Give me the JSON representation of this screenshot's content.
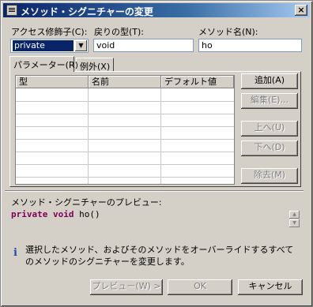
{
  "window": {
    "title": "メソッド・シグニチャーの変更",
    "close_label": "×"
  },
  "fields": {
    "access_label": "アクセス修飾子(C):",
    "access_value": "private",
    "return_label": "戻りの型(T):",
    "return_value": "void",
    "name_label": "メソッド名(N):",
    "name_value": "ho"
  },
  "tabs": [
    {
      "label": "パラメーター(R)"
    },
    {
      "label": "例外(X)"
    }
  ],
  "table": {
    "columns": [
      "型",
      "名前",
      "デフォルト値"
    ]
  },
  "side_buttons": {
    "add": "追加(A)",
    "edit": "編集(E)...",
    "up": "上へ(U)",
    "down": "下へ(D)",
    "remove": "除去(M)"
  },
  "preview": {
    "label": "メソッド・シグニチャーのプレビュー:",
    "keyword1": "private",
    "keyword2": "void",
    "rest": " ho()"
  },
  "info": {
    "text": "選択したメソッド、およびそのメソッドをオーバーライドするすべてのメソッドのシグニチャーを変更します。"
  },
  "footer_buttons": {
    "preview": "プレビュー(W) >",
    "ok": "OK",
    "cancel": "キャンセル"
  },
  "icons": {
    "window_icon": "menu-icon",
    "info_icon": "info-icon",
    "dropdown_icon": "chevron-down-icon"
  }
}
